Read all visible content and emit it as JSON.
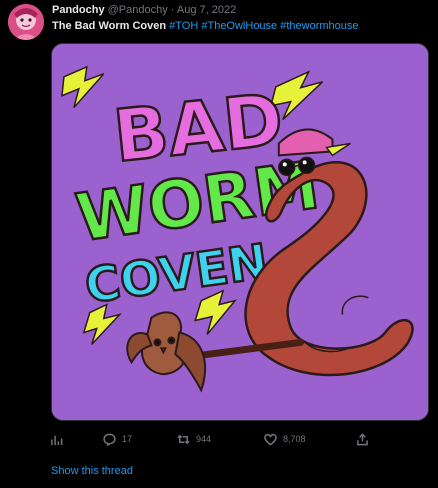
{
  "author": {
    "name": "Pandochy",
    "handle": "@Pandochy",
    "separator": "·",
    "date": "Aug 7, 2022"
  },
  "tweet": {
    "title": "The Bad Worm Coven",
    "hashtags": [
      "#TOH",
      "#TheOwlHouse",
      "#thewormhouse"
    ]
  },
  "media": {
    "art_text": [
      "BAD",
      "WORM",
      "COVEN"
    ],
    "colors": {
      "background": "#9b62cf",
      "bad": "#e66de0",
      "worm": "#63e84a",
      "coven": "#3fd2ef",
      "bolt": "#e6f23a",
      "worm_body": "#b3483a",
      "hat": "#e55fb0",
      "staff": "#4a1f16",
      "owl": "#a05a3e"
    }
  },
  "actions": {
    "replies": "17",
    "retweets": "944",
    "likes": "8,708"
  },
  "thread_link": "Show this thread"
}
